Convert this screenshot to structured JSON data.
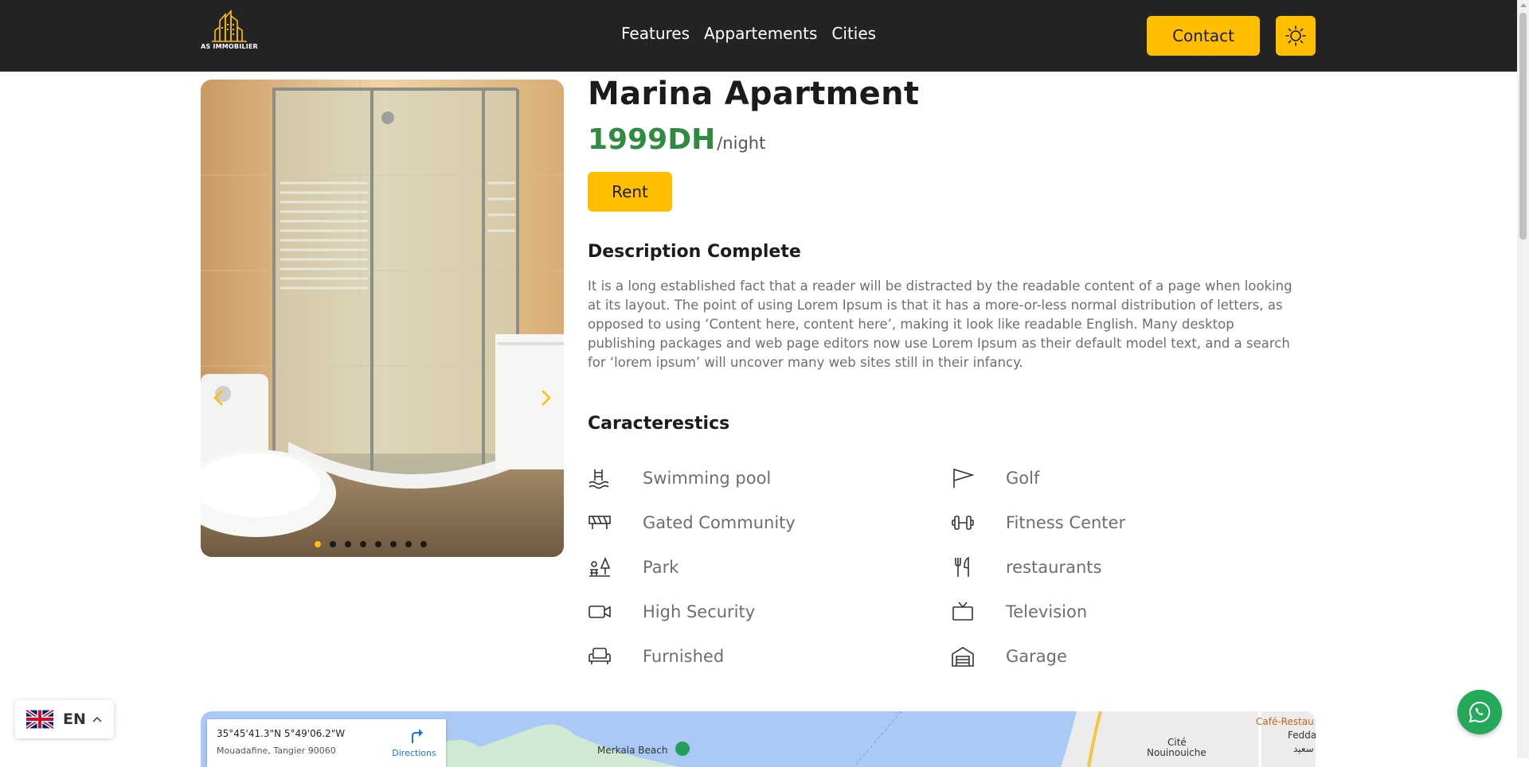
{
  "header": {
    "logo_text": "AS IMMOBILIER",
    "nav": [
      {
        "label": "Features"
      },
      {
        "label": "Appartements"
      },
      {
        "label": "Cities"
      }
    ],
    "contact_label": "Contact",
    "theme_icon": "sun-icon"
  },
  "listing": {
    "title": "Marina Apartment",
    "price": "1999DH",
    "price_unit": "/night",
    "rent_label": "Rent",
    "description_title": "Description Complete",
    "description": "It is a long established fact that a reader will be distracted by the readable content of a page when looking at its layout. The point of using Lorem Ipsum is that it has a more-or-less normal distribution of letters, as opposed to using ‘Content here, content here’, making it look like readable English. Many desktop publishing packages and web page editors now use Lorem Ipsum as their default model text, and a search for ‘lorem ipsum’ will uncover many web sites still in their infancy.",
    "characteristics_title": "Caracterestics",
    "features": [
      {
        "label": "Swimming pool",
        "icon": "swimming-pool-icon"
      },
      {
        "label": "Golf",
        "icon": "golf-flag-icon"
      },
      {
        "label": "Gated Community",
        "icon": "gate-icon"
      },
      {
        "label": "Fitness Center",
        "icon": "dumbbell-icon"
      },
      {
        "label": "Park",
        "icon": "park-icon"
      },
      {
        "label": "restaurants",
        "icon": "utensils-icon"
      },
      {
        "label": "High Security",
        "icon": "video-camera-icon"
      },
      {
        "label": "Television",
        "icon": "tv-icon"
      },
      {
        "label": "Furnished",
        "icon": "armchair-icon"
      },
      {
        "label": "Garage",
        "icon": "garage-icon"
      }
    ]
  },
  "carousel": {
    "image": "bathroom-shower-photo",
    "slide_count": 8,
    "active_slide": 1
  },
  "map": {
    "coords": "35°45'41.3\"N 5°49'06.2\"W",
    "address": "Mouadafine, Tangier 90060",
    "directions_label": "Directions",
    "labels": {
      "merkala": "Merkala Beach",
      "cafe": "Café-Restau",
      "fedda": "Fedda",
      "cite": "Cité",
      "nouinouiche": "Nouinouiche",
      "arabic": "سعيد"
    }
  },
  "language": {
    "code": "EN",
    "flag": "uk-flag-icon"
  },
  "colors": {
    "accent": "#ffbf00",
    "header_bg": "#232323",
    "price": "#2e8b3f",
    "whatsapp": "#25a85a"
  }
}
